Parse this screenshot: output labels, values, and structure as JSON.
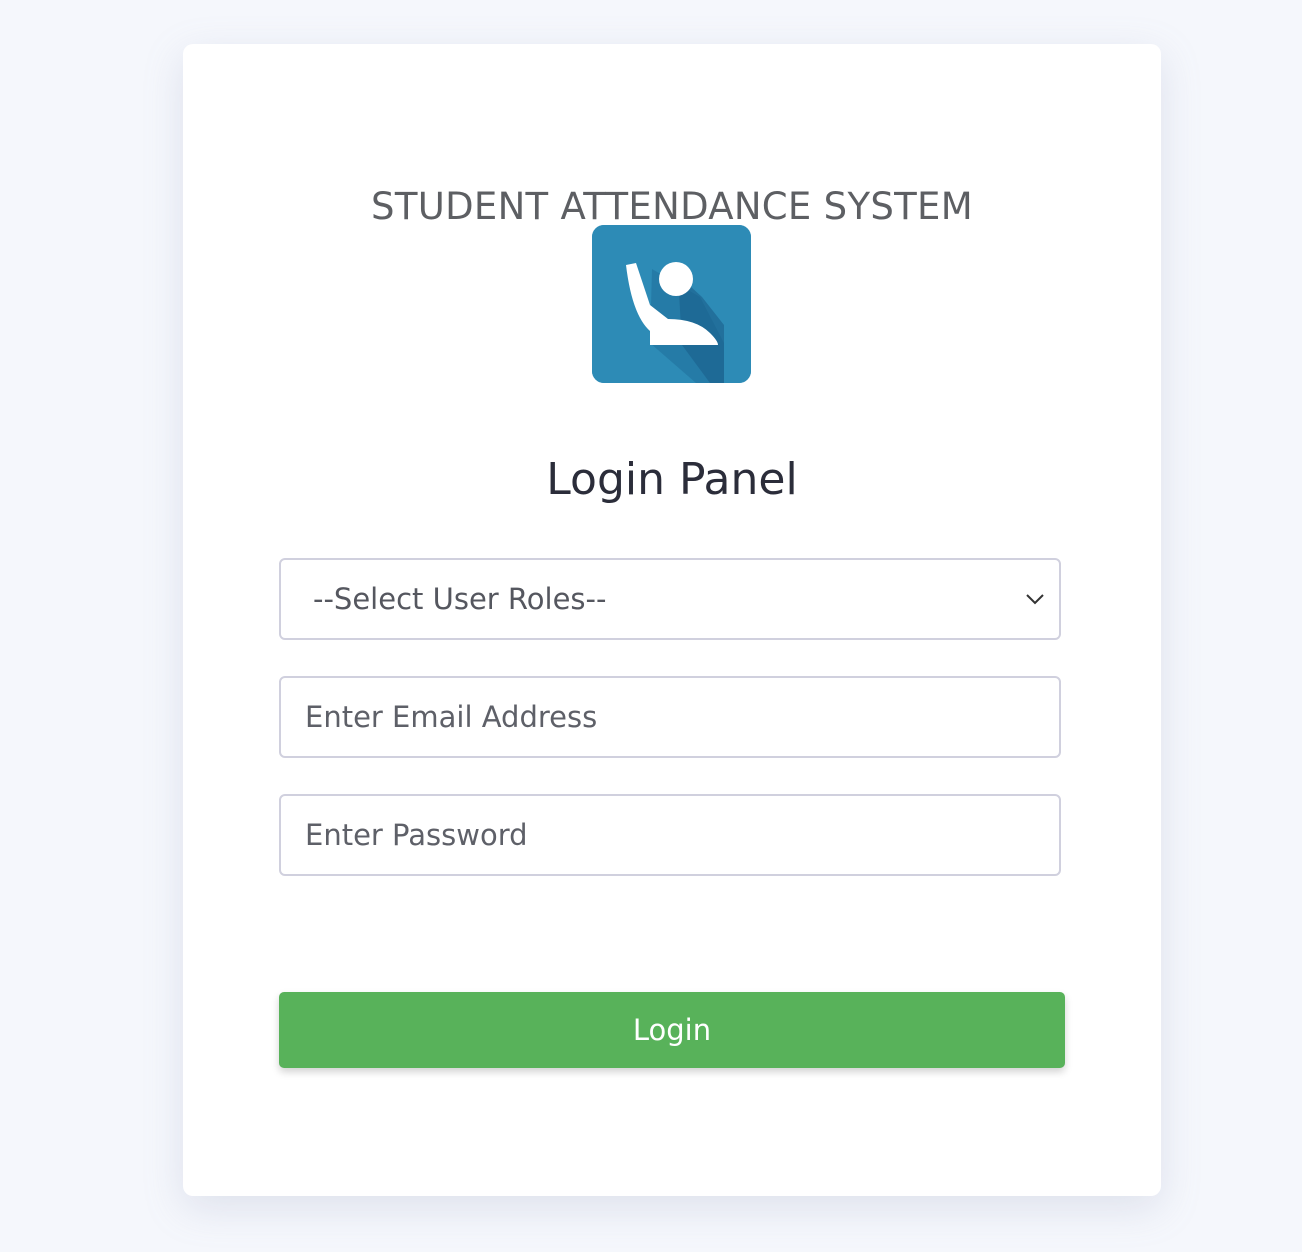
{
  "app": {
    "system_title": "STUDENT ATTENDANCE SYSTEM",
    "panel_title": "Login Panel"
  },
  "logo": {
    "icon": "student-raised-hand-icon",
    "background_color": "#2d8bb6"
  },
  "form": {
    "role_select": {
      "selected_label": "--Select User Roles--"
    },
    "email": {
      "placeholder": "Enter Email Address",
      "value": ""
    },
    "password": {
      "placeholder": "Enter Password",
      "value": ""
    },
    "login_label": "Login"
  },
  "colors": {
    "page_background": "#f5f7fc",
    "card_background": "#ffffff",
    "login_button": "#58b25a",
    "input_border": "#d0d0de"
  }
}
